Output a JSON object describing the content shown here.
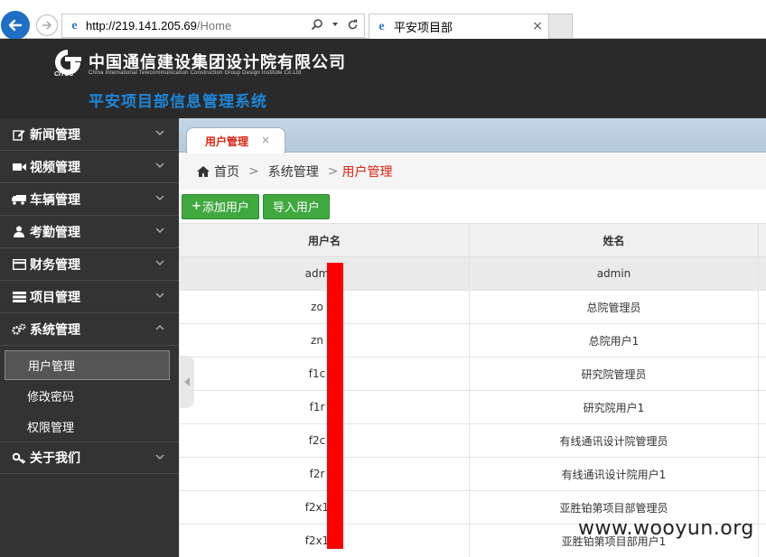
{
  "browser": {
    "url_host": "http://219.141.205.69",
    "url_path": "/Home",
    "tab_title": "平安项目部",
    "tab_close": "×"
  },
  "header": {
    "company_name": "中国通信建设集团设计院有限公司",
    "company_en": "China International Telecommunication Construction Group Design Institute Co.Ltd",
    "logo_text": "CITCC",
    "system_name": "平安项目部信息管理系统"
  },
  "sidebar": {
    "items": [
      {
        "label": "新闻管理",
        "icon": "edit-icon"
      },
      {
        "label": "视频管理",
        "icon": "video-icon"
      },
      {
        "label": "车辆管理",
        "icon": "truck-icon"
      },
      {
        "label": "考勤管理",
        "icon": "user-icon"
      },
      {
        "label": "财务管理",
        "icon": "credit-card-icon"
      },
      {
        "label": "项目管理",
        "icon": "list-icon"
      },
      {
        "label": "系统管理",
        "icon": "cogs-icon"
      }
    ],
    "sub_items": [
      {
        "label": "用户管理",
        "active": true
      },
      {
        "label": "修改密码",
        "active": false
      },
      {
        "label": "权限管理",
        "active": false
      }
    ],
    "last_item": {
      "label": "关于我们",
      "icon": "key-icon"
    }
  },
  "content": {
    "tab_label": "用户管理",
    "tab_close": "×",
    "breadcrumb": {
      "home": "首页",
      "sep": ">",
      "level1": "系统管理",
      "current": "用户管理"
    },
    "toolbar": {
      "add_plus": "+",
      "add_label": "添加用户",
      "import_label": "导入用户"
    },
    "table": {
      "headers": [
        "用户名",
        "姓名"
      ],
      "rows": [
        {
          "username": "adm",
          "name": "admin"
        },
        {
          "username": "zo",
          "name": "总院管理员"
        },
        {
          "username": "zn",
          "name": "总院用户1"
        },
        {
          "username": "f1c",
          "name": "研究院管理员"
        },
        {
          "username": "f1r",
          "name": "研究院用户1"
        },
        {
          "username": "f2c",
          "name": "有线通讯设计院管理员"
        },
        {
          "username": "f2r",
          "name": "有线通讯设计院用户1"
        },
        {
          "username": "f2x1",
          "name": "亚胜铂第项目部管理员"
        },
        {
          "username": "f2x1",
          "name": "亚胜铂第项目部用户1"
        }
      ]
    }
  },
  "watermark": "www.wooyun.org",
  "colors": {
    "accent_red": "#dd2211",
    "button_green": "#3fa93f",
    "sidebar_bg": "#333333",
    "header_bg": "#2a2a2a",
    "system_title_blue": "#1f86d8"
  }
}
